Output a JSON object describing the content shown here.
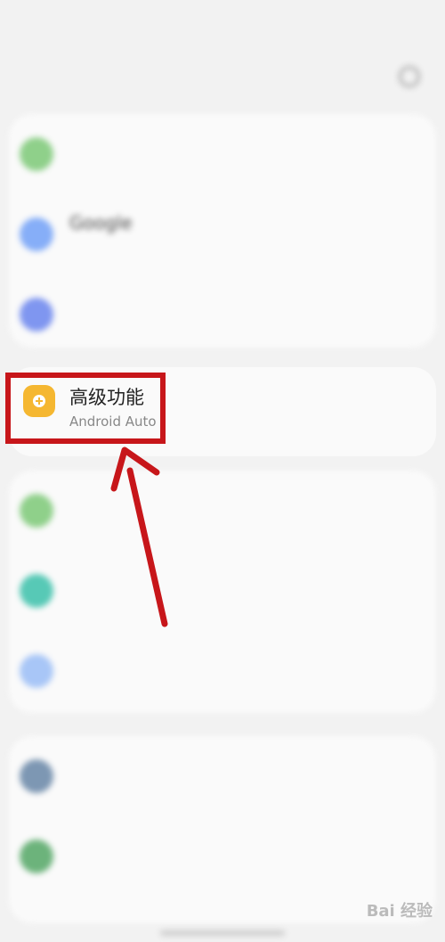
{
  "status_bar": {
    "time": "",
    "right_icons": ""
  },
  "app_bar": {
    "title": "",
    "search_icon": "search-icon"
  },
  "groups": [
    {
      "items": [
        {
          "title": "",
          "subtitle": "",
          "color": "#8fd08a"
        },
        {
          "title": "Google",
          "subtitle": "",
          "color": "#86aef8"
        },
        {
          "title": "",
          "subtitle": "",
          "color": "#7f96f0"
        }
      ]
    },
    {
      "items": [
        {
          "title": "高级功能",
          "subtitle": "Android Auto",
          "color": "#f5b731",
          "highlighted": true
        }
      ]
    },
    {
      "items": [
        {
          "title": "",
          "subtitle": "",
          "color": "#8fd08a"
        },
        {
          "title": "",
          "subtitle": "",
          "color": "#57c9b6"
        },
        {
          "title": "",
          "subtitle": "",
          "color": "#a8c6f7"
        }
      ]
    },
    {
      "items": [
        {
          "title": "",
          "subtitle": "",
          "color": "#7d97b3"
        },
        {
          "title": "",
          "subtitle": "",
          "color": "#6cb37b"
        }
      ]
    }
  ],
  "watermark": "Bai 经验",
  "annotation_color": "#c7161a"
}
